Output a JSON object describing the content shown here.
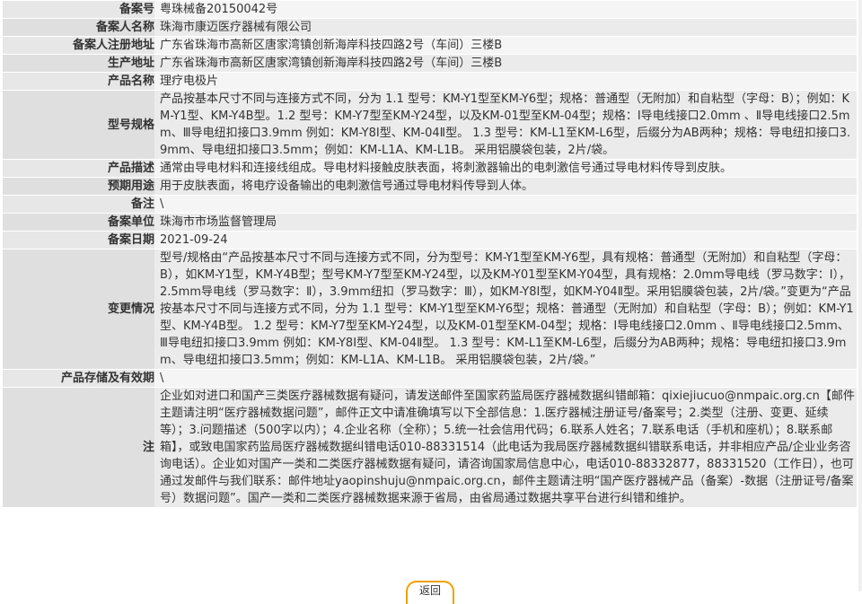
{
  "fields": [
    {
      "label": "备案号",
      "value": "粤珠械备20150042号"
    },
    {
      "label": "备案人名称",
      "value": "珠海市康迈医疗器械有限公司"
    },
    {
      "label": "备案人注册地址",
      "value": "广东省珠海市高新区唐家湾镇创新海岸科技四路2号（车间）三楼B"
    },
    {
      "label": "生产地址",
      "value": "广东省珠海市高新区唐家湾镇创新海岸科技四路2号（车间）三楼B"
    },
    {
      "label": "产品名称",
      "value": "理疗电极片"
    },
    {
      "label": "型号规格",
      "value": "产品按基本尺寸不同与连接方式不同，分为 1.1 型号：KM-Y1型至KM-Y6型；规格：普通型（无附加）和自粘型（字母：B）；例如：KM-Y1型、KM-Y4B型。1.2 型号：KM-Y7型至KM-Y24型，以及KM-01型至KM-04型；规格：Ⅰ导电线接口2.0mm 、Ⅱ导电线接口2.5mm、Ⅲ导电纽扣接口3.9mm 例如：KM-Y8Ⅰ型、KM-04Ⅱ型。 1.3 型号：KM-L1至KM-L6型，后缀分为AB两种；规格：导电纽扣接口3.9mm、导电纽扣接口3.5mm；例如：KM-L1A、KM-L1B。 采用铝膜袋包装，2片/袋。"
    },
    {
      "label": "产品描述",
      "value": "通常由导电材料和连接线组成。导电材料接触皮肤表面，将刺激器输出的电刺激信号通过导电材料传导到皮肤。"
    },
    {
      "label": "预期用途",
      "value": "用于皮肤表面，将电疗设备输出的电刺激信号通过导电材料传导到人体。"
    },
    {
      "label": "备注",
      "value": "\\"
    },
    {
      "label": "备案单位",
      "value": "珠海市市场监督管理局"
    },
    {
      "label": "备案日期",
      "value": "2021-09-24"
    },
    {
      "label": "变更情况",
      "value": "型号/规格由“产品按基本尺寸不同与连接方式不同，分为型号：KM-Y1型至KM-Y6型，具有规格：普通型（无附加）和自粘型（字母：B），如KM-Y1型，KM-Y4B型；型号KM-Y7型至KM-Y24型，以及KM-Y01型至KM-Y04型，具有规格：2.0mm导电线（罗马数字：Ⅰ），2.5mm导电线（罗马数字：Ⅱ），3.9mm纽扣（罗马数字：Ⅲ），如KM-Y8Ⅰ型，如KM-Y04Ⅱ型。采用铝膜袋包装，2片/袋。”变更为“产品按基本尺寸不同与连接方式不同，分为 1.1 型号：KM-Y1型至KM-Y6型；规格：普通型（无附加）和自粘型（字母：B）；例如：KM-Y1型、KM-Y4B型。 1.2 型号：KM-Y7型至KM-Y24型，以及KM-01型至KM-04型；规格：Ⅰ导电线接口2.0mm 、Ⅱ导电线接口2.5mm、Ⅲ导电纽扣接口3.9mm 例如：KM-Y8Ⅰ型、KM-04Ⅱ型。 1.3 型号：KM-L1至KM-L6型，后缀分为AB两种；规格：导电纽扣接口3.9mm、导电纽扣接口3.5mm；例如：KM-L1A、KM-L1B。 采用铝膜袋包装，2片/袋。”"
    },
    {
      "label": "产品存储及有效期",
      "value": "\\"
    },
    {
      "label": "注",
      "value": "企业如对进口和国产三类医疗器械数据有疑问，请发送邮件至国家药监局医疗器械数据纠错邮箱：qixiejiucuo@nmpaic.org.cn【邮件主题请注明“医疗器械数据问题”，邮件正文中请准确填写以下全部信息：1.医疗器械注册证号/备案号；2.类型（注册、变更、延续等）；3.问题描述（500字以内）；4.企业名称（全称）；5.统一社会信用代码；6.联系人姓名；7.联系电话（手机和座机）；8.联系邮箱】，或致电国家药监局医疗器械数据纠错电话010-88331514（此电话为我局医疗器械数据纠错联系电话，并非相应产品/企业业务咨询电话）。企业如对国产一类和二类医疗器械数据有疑问，请咨询国家局信息中心，电话010-88332877，88331520（工作日），也可通过发邮件与我们联系：邮件地址yaopinshuju@nmpaic.org.cn，邮件主题请注明“国产医疗器械产品（备案）-数据（注册证号/备案号）数据问题”。国产一类和二类医疗器械数据来源于省局，由省局通过数据共享平台进行纠错和维护。"
    }
  ],
  "back_button": {
    "label": "返回"
  }
}
